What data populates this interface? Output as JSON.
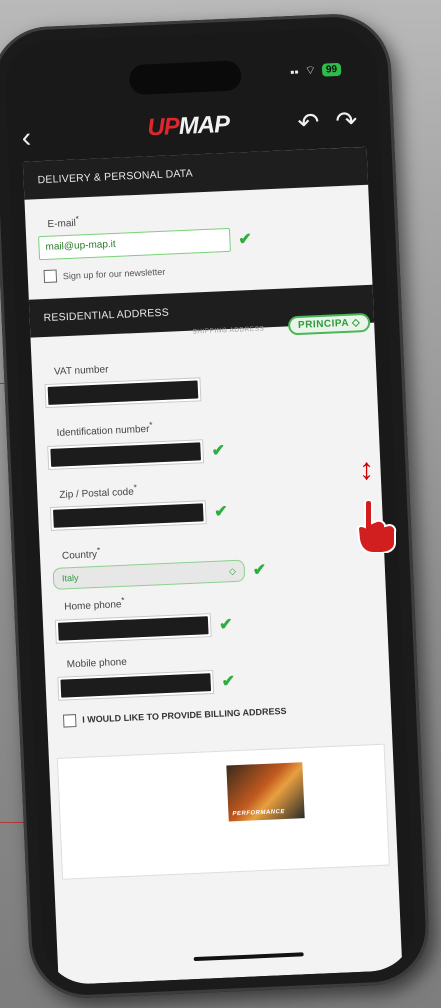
{
  "statusbar": {
    "signal": "▪▪",
    "wifi": "⌔",
    "battery": "99"
  },
  "navbar": {
    "back_icon": "chevron-left",
    "logo_part_a": "UP",
    "logo_part_b": "MAP",
    "undo_icon": "undo-arrow",
    "redo_icon": "redo-arrow"
  },
  "section_delivery": {
    "title": "DELIVERY & PERSONAL DATA",
    "email_label": "E-mail",
    "email_value": "mail@up-map.it",
    "newsletter_label": "Sign up for our newsletter"
  },
  "section_residential": {
    "title": "RESIDENTIAL ADDRESS",
    "saved_caption": "SHIPPING ADDRESS",
    "principal_badge": "PRINCIPA",
    "vat_label": "VAT number",
    "id_label": "Identification number",
    "zip_label": "Zip / Postal code",
    "country_label": "Country",
    "country_value": "Italy",
    "home_phone_label": "Home phone",
    "mobile_phone_label": "Mobile phone",
    "billing_label": "I WOULD LIKE TO PROVIDE BILLING ADDRESS"
  },
  "promo": {
    "caption": "PERFORMANCE"
  },
  "colors": {
    "accent_green": "#2dae3e",
    "brand_red": "#e0262d",
    "header_dark": "#1e1e1e"
  }
}
